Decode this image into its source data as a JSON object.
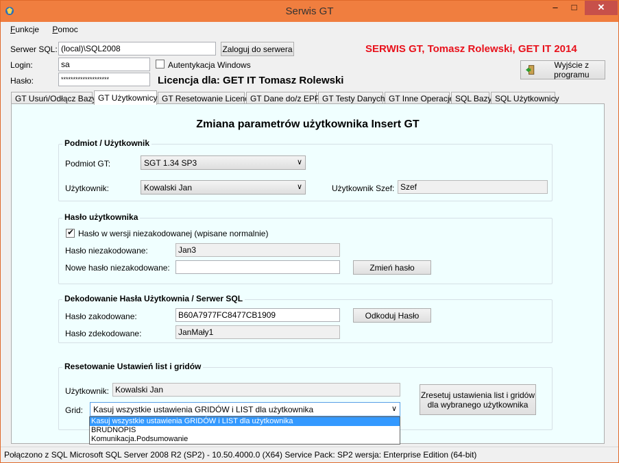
{
  "window": {
    "title": "Serwis GT"
  },
  "menu": [
    {
      "label": "Funkcje",
      "accel": "F",
      "rest": "unkcje"
    },
    {
      "label": "Pomoc",
      "accel": "P",
      "rest": "omoc"
    }
  ],
  "login": {
    "server_label": "Serwer SQL:",
    "server_value": "(local)\\SQL2008",
    "login_button": "Zaloguj do serwera",
    "login_label": "Login:",
    "login_value": "sa",
    "windows_auth_label": "Autentykacja Windows",
    "windows_auth_checked": false,
    "password_label": "Hasło:",
    "password_value": "********************"
  },
  "brand": "SERWIS GT, Tomasz Rolewski, GET IT 2014",
  "licence": "Licencja dla: GET IT Tomasz Rolewski",
  "exit_button": "Wyjście z programu",
  "tabs": [
    {
      "label": "GT Usuń/Odłącz Bazy",
      "active": false
    },
    {
      "label": "GT Użytkownicy",
      "active": true
    },
    {
      "label": "GT Resetowanie Licencji",
      "active": false
    },
    {
      "label": "GT Dane do/z EPP",
      "active": false
    },
    {
      "label": "GT Testy Danych",
      "active": false
    },
    {
      "label": "GT Inne Operacje",
      "active": false
    },
    {
      "label": "SQL Bazy",
      "active": false
    },
    {
      "label": "SQL Użytkownicy",
      "active": false
    }
  ],
  "panel": {
    "title": "Zmiana parametrów użytkownika Insert GT",
    "subject": {
      "group_title": "Podmiot / Użytkownik",
      "subject_label": "Podmiot GT:",
      "subject_value": "SGT 1.34 SP3",
      "user_label": "Użytkownik:",
      "user_value": "Kowalski Jan",
      "boss_label": "Użytkownik Szef:",
      "boss_value": "Szef"
    },
    "password": {
      "group_title": "Hasło użytkownika",
      "plain_checkbox_label": "Hasło w wersji niezakodowanej (wpisane normalnie)",
      "plain_checked": true,
      "plain_label": "Hasło niezakodowane:",
      "plain_value": "Jan3",
      "new_label": "Nowe hasło niezakodowane:",
      "new_value": "",
      "change_button": "Zmień hasło"
    },
    "decode": {
      "group_title": "Dekodowanie Hasła Użytkownia / Serwer SQL",
      "encoded_label": "Hasło zakodowane:",
      "encoded_value": "B60A7977FC8477CB1909",
      "decode_button": "Odkoduj Hasło",
      "decoded_label": "Hasło zdekodowane:",
      "decoded_value": "JanMały1"
    },
    "reset": {
      "group_title": "Resetowanie Ustawień list i gridów",
      "user_label": "Użytkownik:",
      "user_value": "Kowalski Jan",
      "grid_label": "Grid:",
      "grid_value": "Kasuj wszystkie ustawienia GRIDÓW i LIST dla użytkownika",
      "grid_options": [
        "Kasuj wszystkie ustawienia GRIDÓW i LIST dla użytkownika",
        "BRUDNOPIS",
        "Komunikacja.Podsumowanie"
      ],
      "reset_button_line1": "Zresetuj ustawienia list i gridów",
      "reset_button_line2": "dla wybranego użytkownika"
    }
  },
  "status": "Połączono z SQL  Microsoft SQL Server 2008 R2 (SP2) - 10.50.4000.0 (X64)  Service Pack: SP2  wersja: Enterprise Edition (64-bit)",
  "icons": {
    "app": "app-icon",
    "exit": "exit-door-icon",
    "dropdown": "chevron-down-icon"
  },
  "colors": {
    "titlebar": "#f07e3f",
    "brand_red": "#e8111b",
    "panel_bg": "#f0ffff",
    "selection": "#3399ff"
  }
}
